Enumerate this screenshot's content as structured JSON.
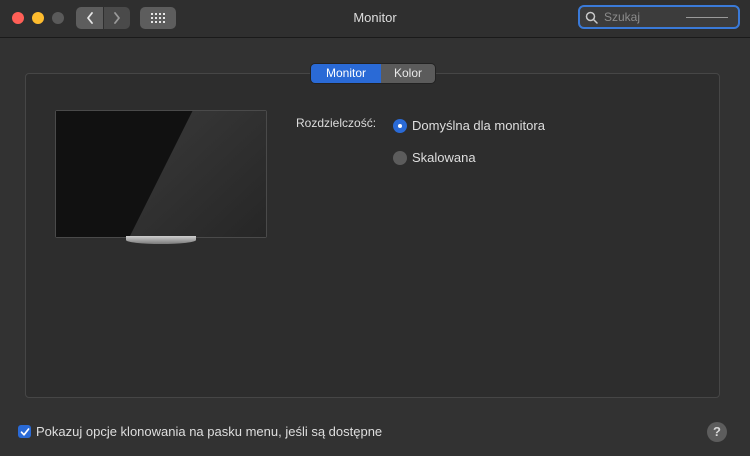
{
  "window": {
    "title": "Monitor"
  },
  "search": {
    "placeholder": "Szukaj"
  },
  "tabs": [
    {
      "label": "Monitor",
      "active": true
    },
    {
      "label": "Kolor",
      "active": false
    }
  ],
  "resolution": {
    "label": "Rozdzielczość:",
    "options": [
      {
        "label": "Domyślna dla monitora",
        "selected": true
      },
      {
        "label": "Skalowana",
        "selected": false
      }
    ]
  },
  "footer": {
    "mirroring_label": "Pokazuj opcje klonowania na pasku menu, jeśli są dostępne",
    "mirroring_checked": true,
    "help_label": "?"
  },
  "colors": {
    "accent": "#2a6ad6",
    "window_bg": "#323232",
    "close": "#ff5f57",
    "minimize": "#febc2e"
  }
}
